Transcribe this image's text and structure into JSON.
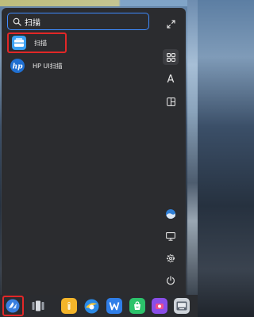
{
  "search": {
    "value": "扫描"
  },
  "results": [
    {
      "label": "扫描",
      "icon": "scanner-app-icon",
      "selected": true
    },
    {
      "label": "HP UI扫描",
      "icon": "hp-logo-icon",
      "selected": false
    }
  ],
  "sidebar": {
    "items": [
      {
        "name": "expand-icon"
      },
      {
        "name": "grid-view-icon",
        "active": true
      },
      {
        "name": "alphabetical-sort-icon",
        "text": "A"
      },
      {
        "name": "category-view-icon"
      },
      {
        "name": "user-avatar-icon"
      },
      {
        "name": "display-settings-icon"
      },
      {
        "name": "settings-gear-icon"
      },
      {
        "name": "power-icon"
      }
    ]
  },
  "taskbar": {
    "items": [
      "launcher-icon",
      "multitasking-icon",
      "file-manager-icon",
      "browser-icon",
      "wps-writer-icon",
      "app-store-icon",
      "media-player-icon",
      "terminal-icon"
    ]
  },
  "colors": {
    "accent": "#3f8cff",
    "highlight_box": "#e22727",
    "panel_bg": "#2b2c2f"
  }
}
